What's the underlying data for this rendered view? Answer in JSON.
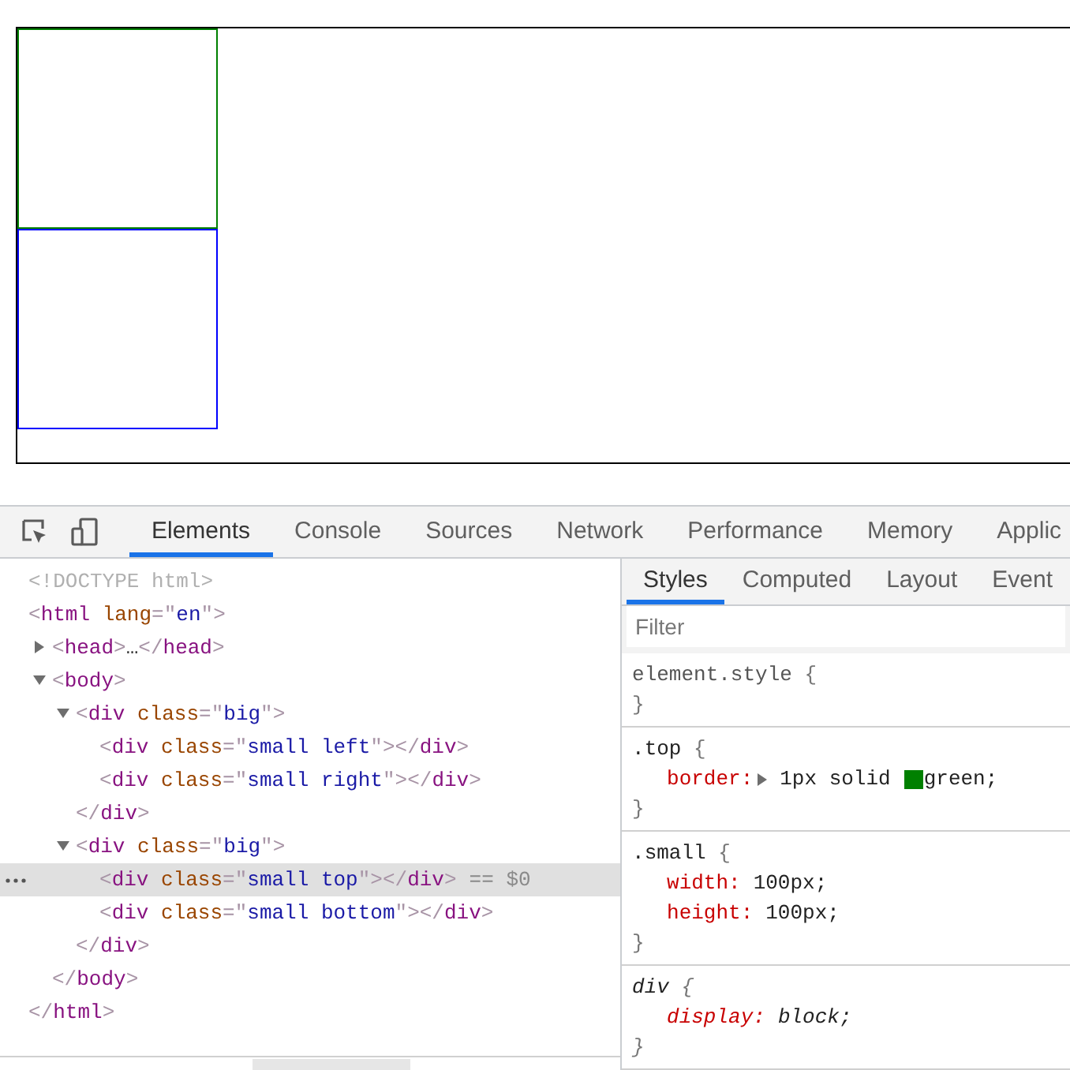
{
  "viewport": {
    "boxes": [
      {
        "color": "#008000"
      },
      {
        "color": "#0000ff"
      }
    ]
  },
  "toolbar": {
    "tabs": [
      {
        "label": "Elements",
        "selected": true
      },
      {
        "label": "Console",
        "selected": false
      },
      {
        "label": "Sources",
        "selected": false
      },
      {
        "label": "Network",
        "selected": false
      },
      {
        "label": "Performance",
        "selected": false
      },
      {
        "label": "Memory",
        "selected": false
      },
      {
        "label": "Applic",
        "selected": false
      }
    ]
  },
  "dom_tree": [
    {
      "selected": false,
      "line": [
        {
          "kind": "doctype",
          "text": "<!DOCTYPE html>"
        }
      ]
    },
    {
      "selected": false,
      "line": [
        {
          "kind": "bracket",
          "text": "<"
        },
        {
          "kind": "tag",
          "text": "html"
        },
        {
          "kind": "attr",
          "text": " lang"
        },
        {
          "kind": "bracket",
          "text": "=\""
        },
        {
          "kind": "value",
          "text": "en"
        },
        {
          "kind": "bracket",
          "text": "\">"
        }
      ],
      "closing": [
        {
          "kind": "bracket",
          "text": "</"
        },
        {
          "kind": "tag",
          "text": "html"
        },
        {
          "kind": "bracket",
          "text": ">"
        }
      ],
      "children": [
        {
          "selected": false,
          "expanded": false,
          "line": [
            {
              "kind": "bracket",
              "text": "<"
            },
            {
              "kind": "tag",
              "text": "head"
            },
            {
              "kind": "bracket",
              "text": ">"
            },
            {
              "kind": "plain",
              "text": "…"
            },
            {
              "kind": "bracket",
              "text": "</"
            },
            {
              "kind": "tag",
              "text": "head"
            },
            {
              "kind": "bracket",
              "text": ">"
            }
          ]
        },
        {
          "selected": false,
          "expanded": true,
          "line": [
            {
              "kind": "bracket",
              "text": "<"
            },
            {
              "kind": "tag",
              "text": "body"
            },
            {
              "kind": "bracket",
              "text": ">"
            }
          ],
          "closing": [
            {
              "kind": "bracket",
              "text": "</"
            },
            {
              "kind": "tag",
              "text": "body"
            },
            {
              "kind": "bracket",
              "text": ">"
            }
          ],
          "children": [
            {
              "selected": false,
              "expanded": true,
              "line": [
                {
                  "kind": "bracket",
                  "text": "<"
                },
                {
                  "kind": "tag",
                  "text": "div"
                },
                {
                  "kind": "attr",
                  "text": " class"
                },
                {
                  "kind": "bracket",
                  "text": "=\""
                },
                {
                  "kind": "value",
                  "text": "big"
                },
                {
                  "kind": "bracket",
                  "text": "\">"
                }
              ],
              "closing": [
                {
                  "kind": "bracket",
                  "text": "</"
                },
                {
                  "kind": "tag",
                  "text": "div"
                },
                {
                  "kind": "bracket",
                  "text": ">"
                }
              ],
              "children": [
                {
                  "selected": false,
                  "line": [
                    {
                      "kind": "bracket",
                      "text": "<"
                    },
                    {
                      "kind": "tag",
                      "text": "div"
                    },
                    {
                      "kind": "attr",
                      "text": " class"
                    },
                    {
                      "kind": "bracket",
                      "text": "=\""
                    },
                    {
                      "kind": "value",
                      "text": "small left"
                    },
                    {
                      "kind": "bracket",
                      "text": "\">"
                    },
                    {
                      "kind": "bracket",
                      "text": "</"
                    },
                    {
                      "kind": "tag",
                      "text": "div"
                    },
                    {
                      "kind": "bracket",
                      "text": ">"
                    }
                  ]
                },
                {
                  "selected": false,
                  "line": [
                    {
                      "kind": "bracket",
                      "text": "<"
                    },
                    {
                      "kind": "tag",
                      "text": "div"
                    },
                    {
                      "kind": "attr",
                      "text": " class"
                    },
                    {
                      "kind": "bracket",
                      "text": "=\""
                    },
                    {
                      "kind": "value",
                      "text": "small right"
                    },
                    {
                      "kind": "bracket",
                      "text": "\">"
                    },
                    {
                      "kind": "bracket",
                      "text": "</"
                    },
                    {
                      "kind": "tag",
                      "text": "div"
                    },
                    {
                      "kind": "bracket",
                      "text": ">"
                    }
                  ]
                }
              ]
            },
            {
              "selected": false,
              "expanded": true,
              "line": [
                {
                  "kind": "bracket",
                  "text": "<"
                },
                {
                  "kind": "tag",
                  "text": "div"
                },
                {
                  "kind": "attr",
                  "text": " class"
                },
                {
                  "kind": "bracket",
                  "text": "=\""
                },
                {
                  "kind": "value",
                  "text": "big"
                },
                {
                  "kind": "bracket",
                  "text": "\">"
                }
              ],
              "closing": [
                {
                  "kind": "bracket",
                  "text": "</"
                },
                {
                  "kind": "tag",
                  "text": "div"
                },
                {
                  "kind": "bracket",
                  "text": ">"
                }
              ],
              "children": [
                {
                  "selected": true,
                  "reference": "== $0",
                  "line": [
                    {
                      "kind": "bracket",
                      "text": "<"
                    },
                    {
                      "kind": "tag",
                      "text": "div"
                    },
                    {
                      "kind": "attr",
                      "text": " class"
                    },
                    {
                      "kind": "bracket",
                      "text": "=\""
                    },
                    {
                      "kind": "value",
                      "text": "small top"
                    },
                    {
                      "kind": "bracket",
                      "text": "\">"
                    },
                    {
                      "kind": "bracket",
                      "text": "</"
                    },
                    {
                      "kind": "tag",
                      "text": "div"
                    },
                    {
                      "kind": "bracket",
                      "text": ">"
                    }
                  ]
                },
                {
                  "selected": false,
                  "line": [
                    {
                      "kind": "bracket",
                      "text": "<"
                    },
                    {
                      "kind": "tag",
                      "text": "div"
                    },
                    {
                      "kind": "attr",
                      "text": " class"
                    },
                    {
                      "kind": "bracket",
                      "text": "=\""
                    },
                    {
                      "kind": "value",
                      "text": "small bottom"
                    },
                    {
                      "kind": "bracket",
                      "text": "\">"
                    },
                    {
                      "kind": "bracket",
                      "text": "</"
                    },
                    {
                      "kind": "tag",
                      "text": "div"
                    },
                    {
                      "kind": "bracket",
                      "text": ">"
                    }
                  ]
                }
              ]
            }
          ]
        }
      ]
    }
  ],
  "styles_pane": {
    "tabs": [
      {
        "label": "Styles",
        "selected": true
      },
      {
        "label": "Computed",
        "selected": false
      },
      {
        "label": "Layout",
        "selected": false
      },
      {
        "label": "Event",
        "selected": false
      }
    ],
    "filter": {
      "placeholder": "Filter"
    },
    "rules": [
      {
        "kind": "inline",
        "selector": "element.style",
        "open": "{",
        "close": "}"
      },
      {
        "kind": "author",
        "selector": ".top",
        "open": "{",
        "close": "}",
        "properties": [
          {
            "name": "border:",
            "expandable": true,
            "value": "1px solid",
            "color": "#008000",
            "value_after": "green;"
          }
        ]
      },
      {
        "kind": "author",
        "selector": ".small",
        "open": "{",
        "close": "}",
        "properties": [
          {
            "name": "width:",
            "value": "100px;"
          },
          {
            "name": "height:",
            "value": "100px;"
          }
        ]
      },
      {
        "kind": "user-agent",
        "selector": "div",
        "open": "{",
        "close": "}",
        "properties": [
          {
            "name": "display:",
            "value": "block;"
          }
        ]
      }
    ]
  }
}
